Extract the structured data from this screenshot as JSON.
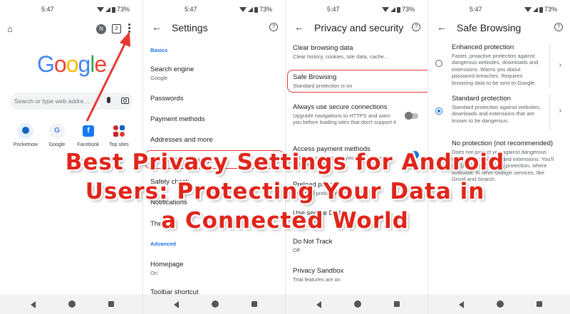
{
  "status": {
    "time": "5:47",
    "battery": "73%"
  },
  "panel1": {
    "search_placeholder": "Search or type web addre…",
    "avatar_letter": "N",
    "tab_count": "2",
    "logo": [
      "G",
      "o",
      "o",
      "g",
      "l",
      "e"
    ],
    "shortcuts": [
      {
        "label": "Pocketnow",
        "icon": "pocketnow-icon"
      },
      {
        "label": "Google",
        "icon": "google-icon",
        "glyph": "G"
      },
      {
        "label": "Facebook",
        "icon": "facebook-icon",
        "glyph": "f"
      },
      {
        "label": "Top sites",
        "icon": "top-sites-icon"
      }
    ]
  },
  "panel2": {
    "title": "Settings",
    "section_basics": "Basics",
    "section_advanced": "Advanced",
    "items": [
      {
        "title": "Search engine",
        "subtitle": "Google"
      },
      {
        "title": "Passwords"
      },
      {
        "title": "Payment methods"
      },
      {
        "title": "Addresses and more"
      },
      {
        "title": "Privacy and security"
      },
      {
        "title": "Safety check"
      },
      {
        "title": "Notifications"
      },
      {
        "title": "Theme"
      },
      {
        "title": "Homepage",
        "subtitle": "On"
      },
      {
        "title": "Toolbar shortcut"
      }
    ]
  },
  "panel3": {
    "title": "Privacy and security",
    "items": [
      {
        "title": "Clear browsing data",
        "subtitle": "Clear history, cookies, site data, cache…"
      },
      {
        "title": "Safe Browsing",
        "subtitle": "Standard protection is on"
      },
      {
        "title": "Always use secure connections",
        "subtitle": "Upgrade navigations to HTTPS and warn you before loading sites that don't support it",
        "toggle": false
      },
      {
        "title": "Access payment methods",
        "subtitle": "Allow sites to check if you have payment methods saved",
        "toggle": true
      },
      {
        "title": "Preload pages",
        "subtitle": "Standard preloading"
      },
      {
        "title": "Use secure DNS",
        "subtitle": "Automatic"
      },
      {
        "title": "Do Not Track",
        "subtitle": "Off"
      },
      {
        "title": "Privacy Sandbox",
        "subtitle": "Trial features are on"
      }
    ]
  },
  "panel4": {
    "title": "Safe Browsing",
    "options": [
      {
        "title": "Enhanced protection",
        "subtitle": "Faster, proactive protection against dangerous websites, downloads and extensions. Warns you about password breaches. Requires browsing data to be sent to Google.",
        "selected": false
      },
      {
        "title": "Standard protection",
        "subtitle": "Standard protection against websites, downloads and extensions that are known to be dangerous.",
        "selected": true
      },
      {
        "title": "No protection (not recommended)",
        "subtitle": "Does not protect you against dangerous websites, downloads and extensions. You'll still get Safe Browsing protection, where available, in other Google services, like Gmail and Search.",
        "selected": false
      }
    ]
  },
  "overlay": {
    "lines": [
      "Best Privacy Settings for Android",
      "Users: Protecting Your Data in",
      "a Connected World"
    ]
  },
  "colors": {
    "accent_red": "#e0251b",
    "link_blue": "#1a73e8"
  }
}
